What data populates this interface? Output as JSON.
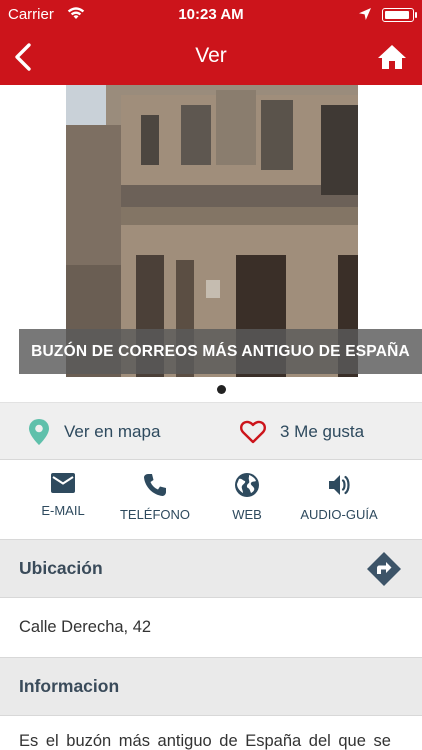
{
  "status_bar": {
    "carrier": "Carrier",
    "time": "10:23 AM",
    "battery_level": 0.95
  },
  "nav": {
    "title": "Ver"
  },
  "gallery": {
    "caption": "BUZÓN DE CORREOS MÁS ANTIGUO DE ESPAÑA",
    "page_count": 1,
    "current_page": 1
  },
  "actions": {
    "map_label": "Ver en mapa",
    "like_label": "3 Me gusta"
  },
  "contact": {
    "email_label": "E-MAIL",
    "phone_label": "TELÉFONO",
    "web_label": "WEB",
    "audio_label": "AUDIO-GUÍA"
  },
  "ubicacion": {
    "title": "Ubicación",
    "address": "Calle Derecha, 42"
  },
  "informacion": {
    "title": "Informacion",
    "text": "Es el buzón más antiguo de España del que se"
  },
  "colors": {
    "brand_red": "#cc141b",
    "map_pin": "#5fc0ab",
    "heart": "#cc141b",
    "icon_dark": "#2e4a5e"
  }
}
